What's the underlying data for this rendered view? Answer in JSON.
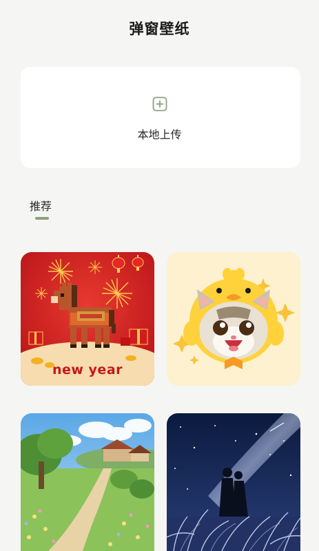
{
  "header": {
    "title": "弹窗壁纸"
  },
  "upload": {
    "label": "本地上传",
    "icon": "add-square-icon"
  },
  "tabs": [
    {
      "label": "推荐",
      "active": true
    }
  ],
  "colors": {
    "accent": "#8aa07e",
    "background": "#f5f5f3",
    "card": "#ffffff"
  },
  "wallpapers": [
    {
      "caption": "new year"
    }
  ]
}
